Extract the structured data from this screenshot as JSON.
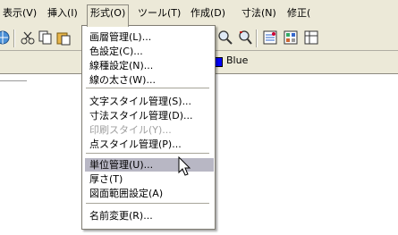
{
  "menubar": {
    "items": [
      {
        "label": "表示(V)"
      },
      {
        "label": "挿入(I)"
      },
      {
        "label": "形式(O)"
      },
      {
        "label": "ツール(T)"
      },
      {
        "label": "作成(D)"
      },
      {
        "label": "寸法(N)"
      },
      {
        "label": "修正("
      }
    ]
  },
  "toolbar": {
    "icons": [
      "globe-icon",
      "cut-icon",
      "copy-icon",
      "paste-icon",
      "zoom-icon",
      "zoom-previous-icon",
      "properties-icon",
      "design-center-icon",
      "tool-palette-icon"
    ]
  },
  "properties": {
    "color_label": "Blue",
    "color_value": "#0000ff"
  },
  "format_menu": {
    "groups": [
      {
        "items": [
          {
            "label": "画層管理(L)..."
          },
          {
            "label": "色設定(C)..."
          },
          {
            "label": "線種設定(N)..."
          },
          {
            "label": "線の太さ(W)..."
          }
        ]
      },
      {
        "items": [
          {
            "label": "文字スタイル管理(S)..."
          },
          {
            "label": "寸法スタイル管理(D)..."
          },
          {
            "label": "印刷スタイル(Y)..."
          },
          {
            "label": "点スタイル管理(P)..."
          }
        ]
      },
      {
        "items": [
          {
            "label": "単位管理(U)..."
          },
          {
            "label": "厚さ(T)"
          },
          {
            "label": "図面範囲設定(A)"
          }
        ]
      },
      {
        "items": [
          {
            "label": "名前変更(R)..."
          }
        ]
      }
    ]
  },
  "colors": {
    "menu_highlight": "#b8b7c4",
    "disabled_text": "#a0a0a0",
    "chrome": "#ece9d8"
  }
}
